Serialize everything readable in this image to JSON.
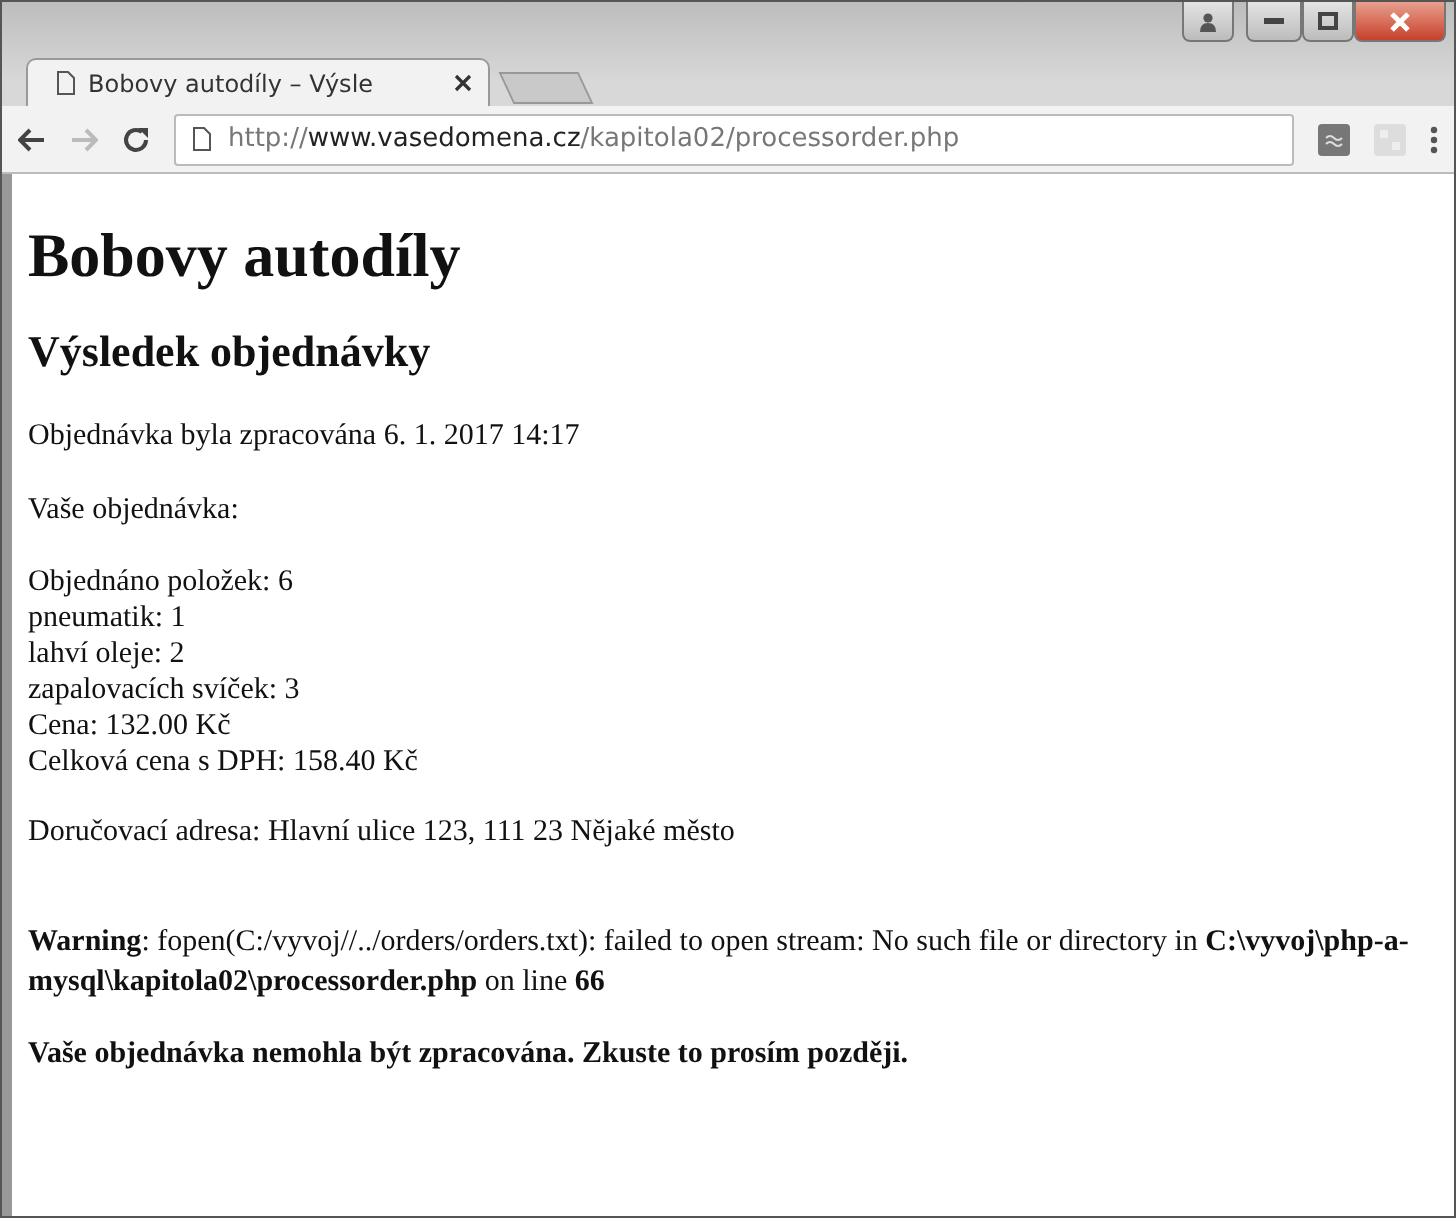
{
  "window": {
    "tabs": [
      {
        "title": "Bobovy autodíly – Výsle",
        "selected": true
      }
    ],
    "address": {
      "scheme": "http://",
      "host": "www.vasedomena.cz",
      "path": "/kapitola02/processorder.php"
    }
  },
  "page": {
    "title": "Bobovy autodíly",
    "subtitle": "Výsledek objednávky",
    "processed": "Objednávka byla zpracována 6. 1. 2017 14:17",
    "order_label": "Vaše objednávka:",
    "order_lines": [
      "Objednáno položek: 6",
      "pneumatik: 1",
      "lahví oleje: 2",
      "zapalovacích svíček: 3",
      "Cena: 132.00 Kč",
      "Celková cena s DPH: 158.40 Kč"
    ],
    "address": "Doručovací adresa: Hlavní ulice 123, 111 23 Nějaké město",
    "warning": "**Warning**: fopen(C:/vyvoj//../orders/orders.txt): failed to open stream: No such file or directory in **C:\\vyvoj\\php-a-mysql\\kapitola02\\processorder.php** on line **66**",
    "error": "Vaše objednávka nemohla být zpracována. Zkuste to prosím později."
  }
}
